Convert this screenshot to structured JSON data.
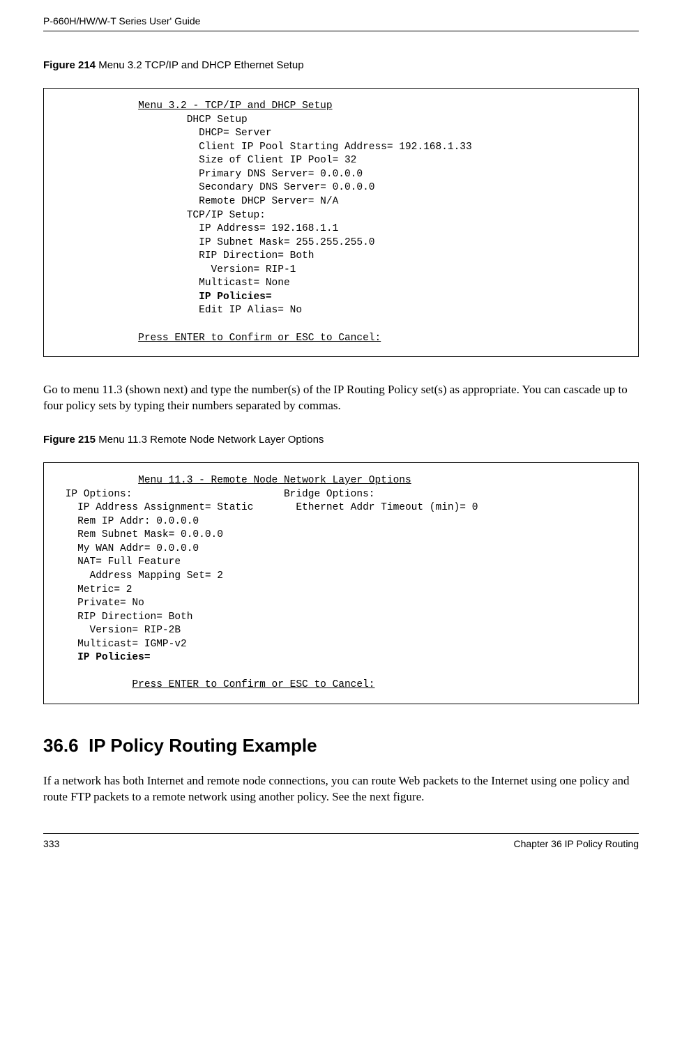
{
  "header": {
    "guide_title": "P-660H/HW/W-T Series User' Guide"
  },
  "figure214": {
    "label_prefix": "Figure 214   ",
    "label_title": "Menu 3.2 TCP/IP and DHCP Ethernet Setup",
    "terminal": {
      "title_indent": "             ",
      "title": "Menu 3.2 - TCP/IP and DHCP Setup",
      "lines_before_bold": "\n                     DHCP Setup\n                       DHCP= Server\n                       Client IP Pool Starting Address= 192.168.1.33\n                       Size of Client IP Pool= 32\n                       Primary DNS Server= 0.0.0.0\n                       Secondary DNS Server= 0.0.0.0\n                       Remote DHCP Server= N/A\n                     TCP/IP Setup:\n                       IP Address= 192.168.1.1\n                       IP Subnet Mask= 255.255.255.0\n                       RIP Direction= Both\n                         Version= RIP-1\n                       Multicast= None\n                       ",
      "bold_line": "IP Policies=",
      "lines_after_bold": "\n                       Edit IP Alias= No\n\n",
      "footer_indent": "             ",
      "footer": "Press ENTER to Confirm or ESC to Cancel:"
    }
  },
  "mid_paragraph": "Go to menu 11.3 (shown next) and type the number(s) of the IP Routing Policy set(s) as appropriate. You can cascade up to four policy sets by typing their numbers separated by commas.",
  "figure215": {
    "label_prefix": "Figure 215   ",
    "label_title": "Menu 11.3 Remote Node Network Layer Options",
    "terminal": {
      "title_indent": "             ",
      "title": "Menu 11.3 - Remote Node Network Layer Options",
      "lines_before_bold": "\n IP Options:                         Bridge Options:\n   IP Address Assignment= Static       Ethernet Addr Timeout (min)= 0\n   Rem IP Addr: 0.0.0.0\n   Rem Subnet Mask= 0.0.0.0\n   My WAN Addr= 0.0.0.0\n   NAT= Full Feature\n     Address Mapping Set= 2\n   Metric= 2\n   Private= No\n   RIP Direction= Both\n     Version= RIP-2B\n   Multicast= IGMP-v2\n   ",
      "bold_line": "IP Policies=",
      "lines_after_bold": "\n\n",
      "footer_indent": "            ",
      "footer": "Press ENTER to Confirm or ESC to Cancel:"
    }
  },
  "section": {
    "number": "36.6",
    "title": "IP Policy Routing Example"
  },
  "section_paragraph": "If a network has both Internet and remote node connections, you can route Web packets to the Internet using one policy and route FTP packets to a remote network using another policy. See the next figure.",
  "footer": {
    "page_number": "333",
    "chapter": "Chapter 36 IP Policy Routing"
  }
}
